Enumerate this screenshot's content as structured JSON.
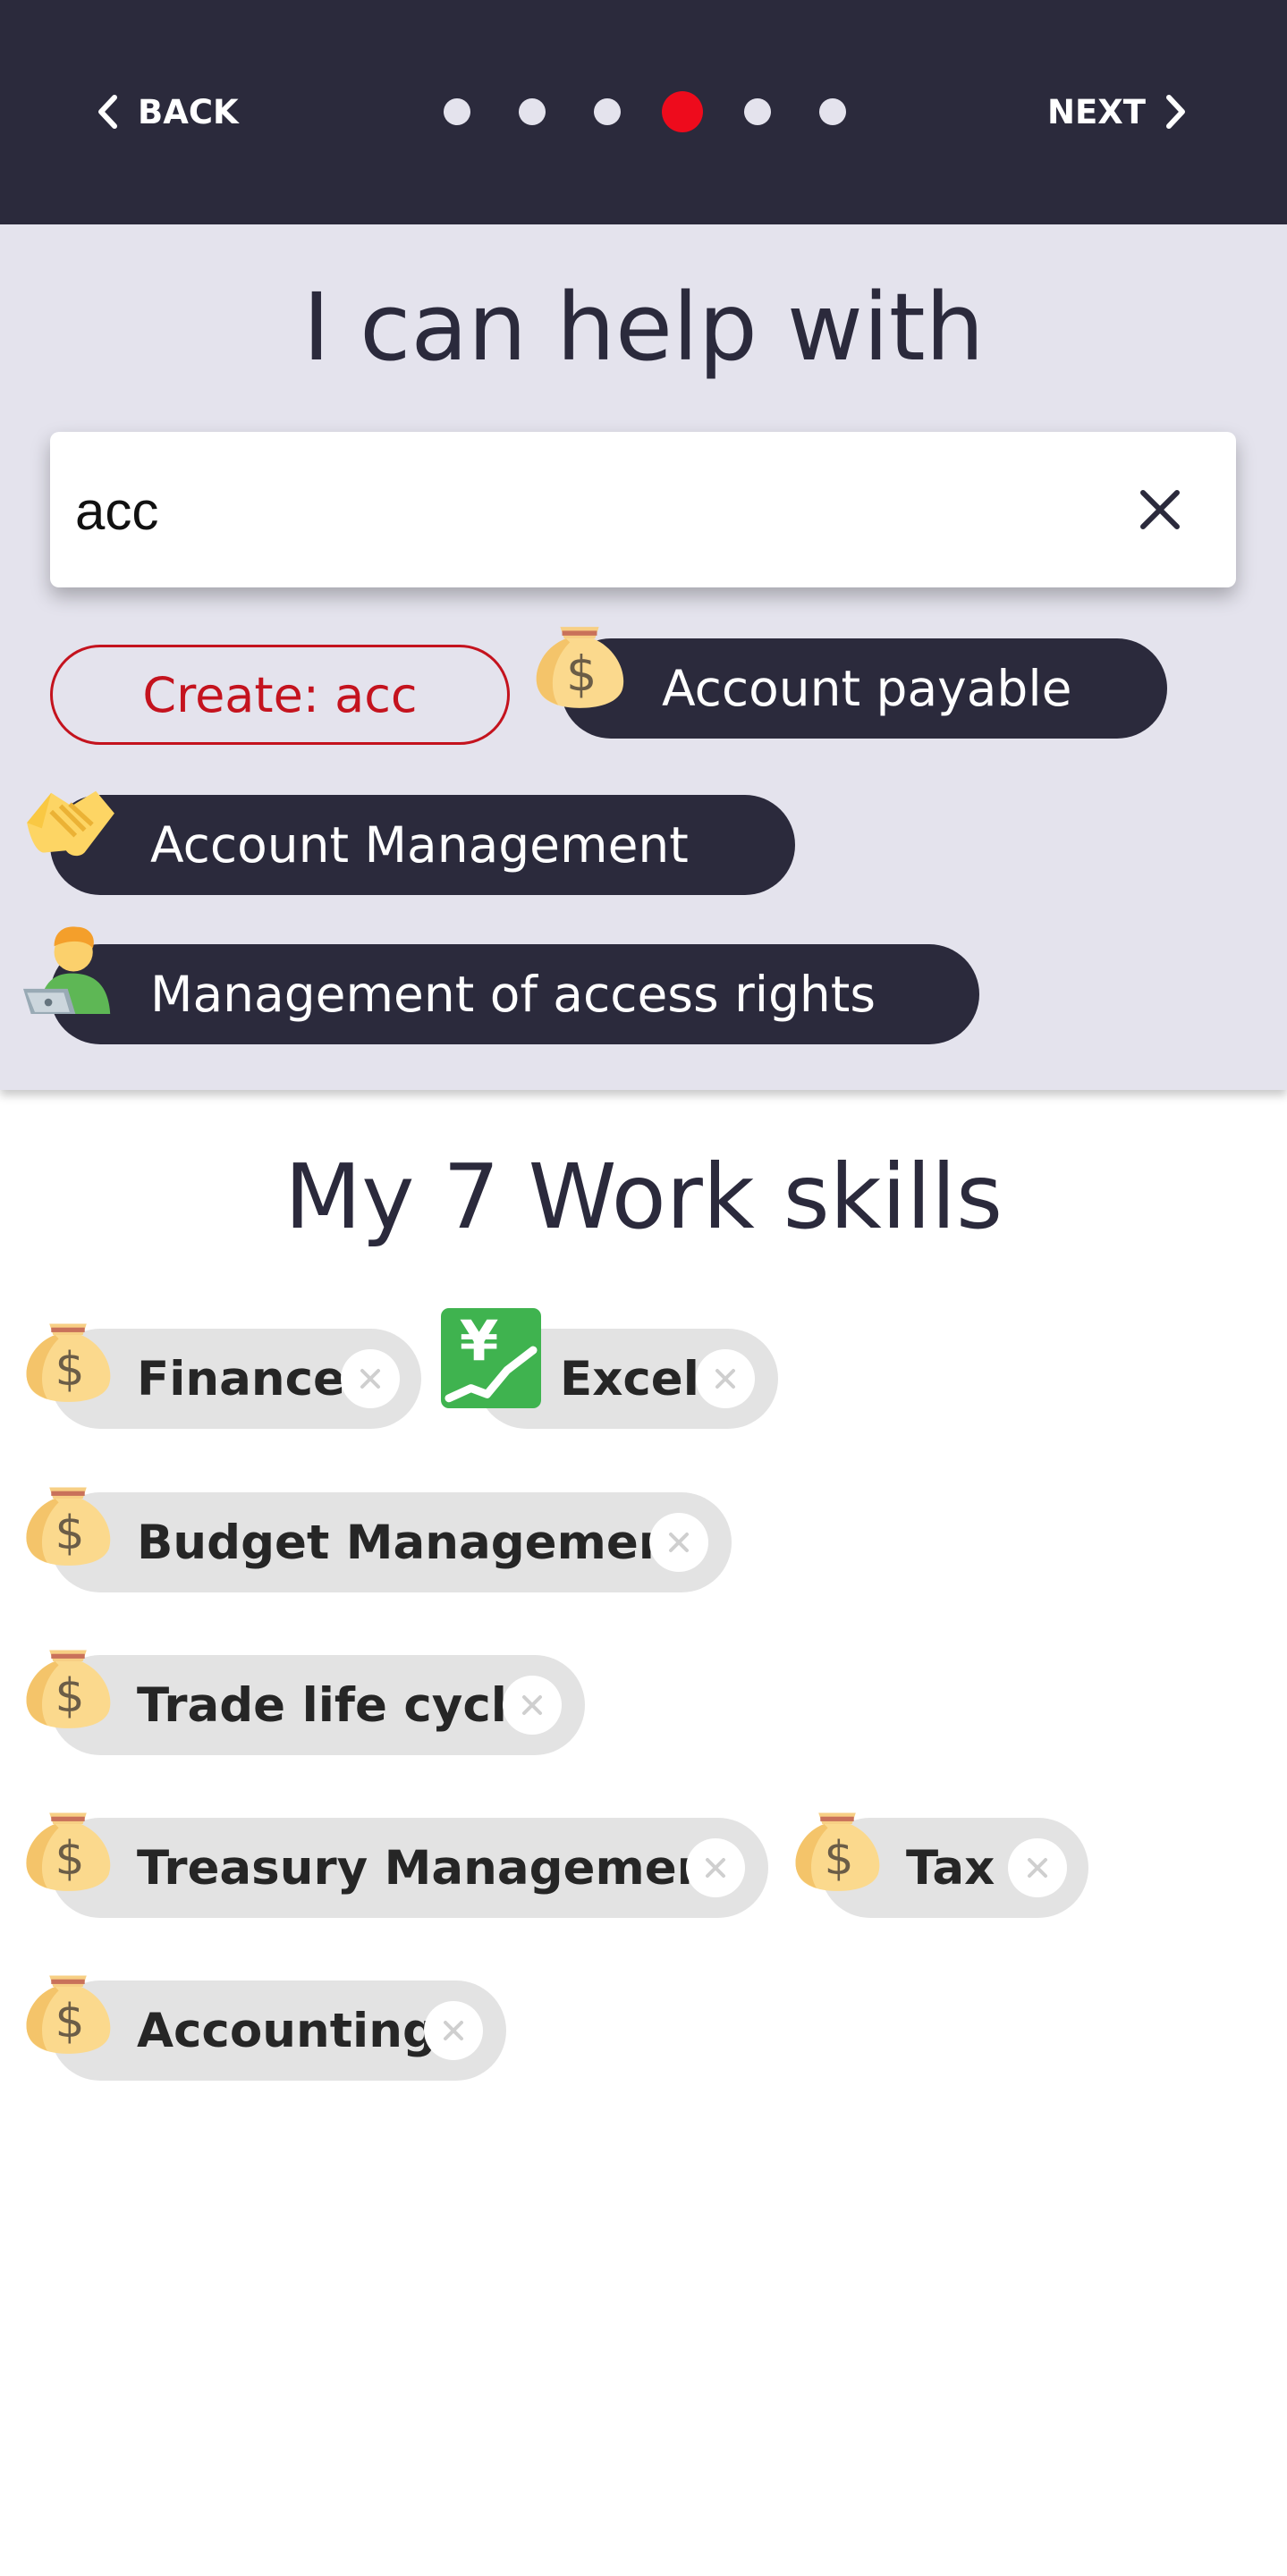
{
  "nav": {
    "back_label": "BACK",
    "next_label": "NEXT",
    "steps": [
      {
        "state": "inactive"
      },
      {
        "state": "inactive"
      },
      {
        "state": "inactive"
      },
      {
        "state": "active"
      },
      {
        "state": "inactive"
      },
      {
        "state": "inactive"
      }
    ],
    "active_step": 4
  },
  "help": {
    "title": "I can help with",
    "search_value": "acc",
    "create_label": "Create: acc",
    "suggestions": [
      {
        "label": "Account payable",
        "icon": "money-bag-icon"
      },
      {
        "label": "Account Management",
        "icon": "handshake-icon"
      },
      {
        "label": "Management of access rights",
        "icon": "technologist-icon"
      }
    ]
  },
  "skills": {
    "title": "My 7 Work skills",
    "items": [
      {
        "label": "Finance",
        "icon": "money-bag-icon"
      },
      {
        "label": "Excel",
        "icon": "chart-yen-icon"
      },
      {
        "label": "Budget Management",
        "icon": "money-bag-icon"
      },
      {
        "label": "Trade life cycle",
        "icon": "money-bag-icon"
      },
      {
        "label": "Treasury Management",
        "icon": "money-bag-icon"
      },
      {
        "label": "Tax",
        "icon": "money-bag-icon"
      },
      {
        "label": "Accounting",
        "icon": "money-bag-icon"
      }
    ]
  },
  "colors": {
    "header_bg": "#2b2a3c",
    "section_bg": "#e4e3ed",
    "accent_red": "#ee0b1c",
    "create_red": "#c4131e",
    "chip_light": "#e3e3e3"
  }
}
